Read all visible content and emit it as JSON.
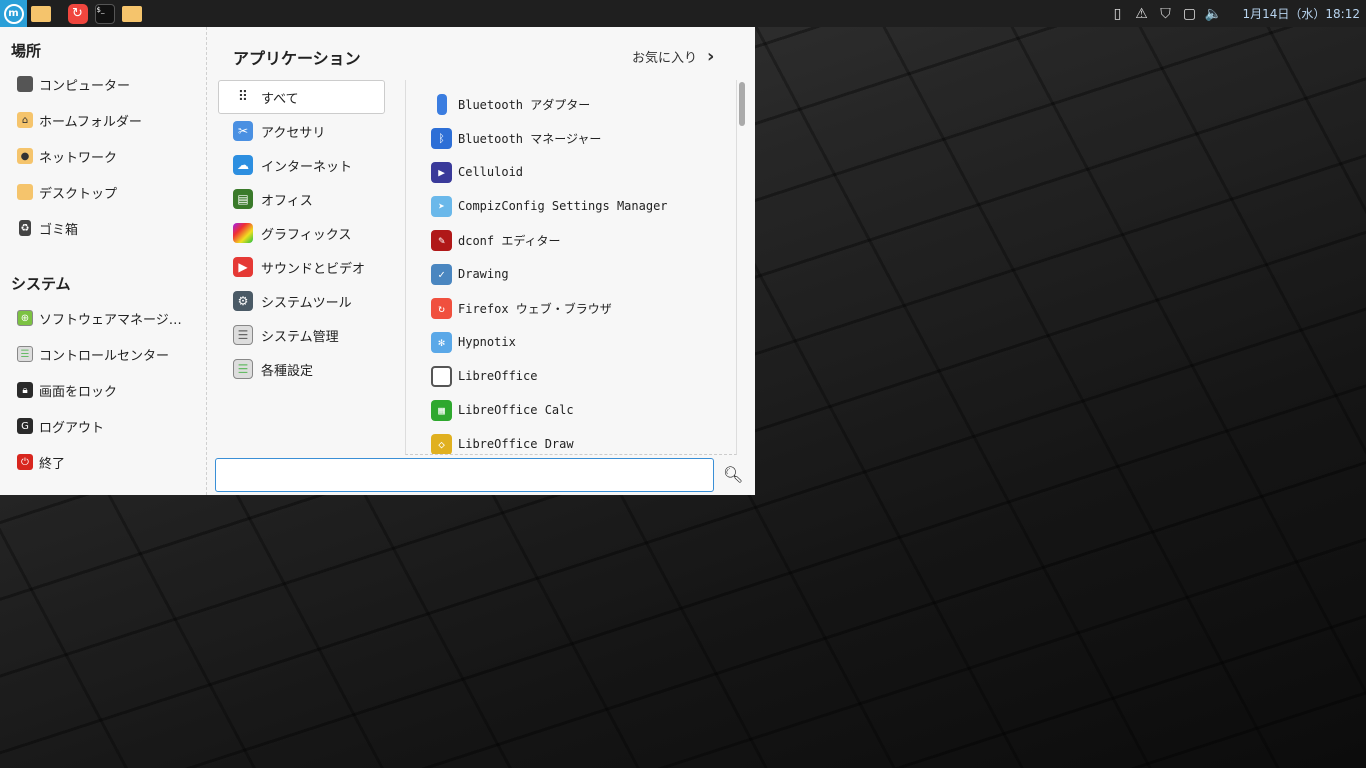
{
  "panel": {
    "launchers": [
      "menu-button",
      "files",
      "firefox",
      "terminal",
      "folder"
    ],
    "clock": "1月14日（水）18:12",
    "tray_icons": [
      "battery-icon",
      "update-icon",
      "shield-icon",
      "network-icon",
      "volume-icon"
    ]
  },
  "places": {
    "title": "場所",
    "items": [
      {
        "label": "コンピューター",
        "icon": "computer-icon"
      },
      {
        "label": "ホームフォルダー",
        "icon": "home-folder-icon"
      },
      {
        "label": "ネットワーク",
        "icon": "network-folder-icon"
      },
      {
        "label": "デスクトップ",
        "icon": "desktop-folder-icon"
      },
      {
        "label": "ゴミ箱",
        "icon": "trash-icon"
      }
    ]
  },
  "system": {
    "title": "システム",
    "items": [
      {
        "label": "ソフトウェアマネージ…",
        "icon": "software-manager-icon"
      },
      {
        "label": "コントロールセンター",
        "icon": "control-center-icon"
      },
      {
        "label": "画面をロック",
        "icon": "lock-icon"
      },
      {
        "label": "ログアウト",
        "icon": "logout-icon"
      },
      {
        "label": "終了",
        "icon": "power-icon"
      }
    ]
  },
  "applications": {
    "title": "アプリケーション",
    "favorites": "お気に入り",
    "categories": [
      "すべて",
      "アクセサリ",
      "インターネット",
      "オフィス",
      "グラフィックス",
      "サウンドとビデオ",
      "システムツール",
      "システム管理",
      "各種設定"
    ],
    "apps": [
      "Bluetooth アダプター",
      "Bluetooth マネージャー",
      "Celluloid",
      "CompizConfig Settings Manager",
      "dconf エディター",
      "Drawing",
      "Firefox ウェブ・ブラウザ",
      "Hypnotix",
      "LibreOffice",
      "LibreOffice Calc",
      "LibreOffice Draw"
    ]
  },
  "search": {
    "value": "",
    "placeholder": ""
  }
}
